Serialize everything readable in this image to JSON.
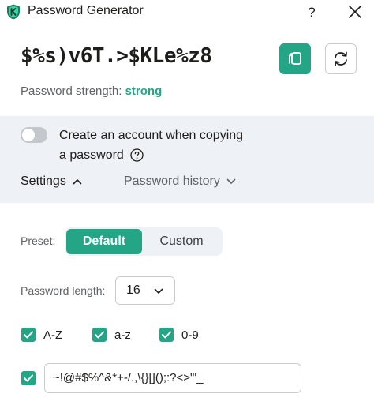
{
  "titlebar": {
    "title": "Password Generator",
    "help_label": "?",
    "icons": {
      "app": "shield-k-icon",
      "close": "close-icon"
    }
  },
  "password": {
    "value": "$%s)v6T.>$KLe%z8",
    "copy_icon": "copy-icon",
    "refresh_icon": "refresh-icon"
  },
  "strength": {
    "label": "Password strength:",
    "value": "strong",
    "color": "#23a586"
  },
  "account": {
    "toggle_on": false,
    "label_line1": "Create an account when copying",
    "label_line2": "a password",
    "info_icon": "question-circle-icon"
  },
  "tabs": {
    "settings": "Settings",
    "history": "Password history"
  },
  "preset": {
    "label": "Preset:",
    "options": [
      "Default",
      "Custom"
    ],
    "selected": "Default"
  },
  "length": {
    "label": "Password length:",
    "value": "16"
  },
  "charsets": [
    {
      "label": "A-Z",
      "checked": true
    },
    {
      "label": "a-z",
      "checked": true
    },
    {
      "label": "0-9",
      "checked": true
    }
  ],
  "symbols": {
    "checked": true,
    "value": "~!@#$%^&*+-/.,\\{}[]();:?<>\"'_"
  },
  "colors": {
    "accent": "#23a586",
    "panel": "#eef1f5",
    "muted_text": "#5e6266"
  }
}
